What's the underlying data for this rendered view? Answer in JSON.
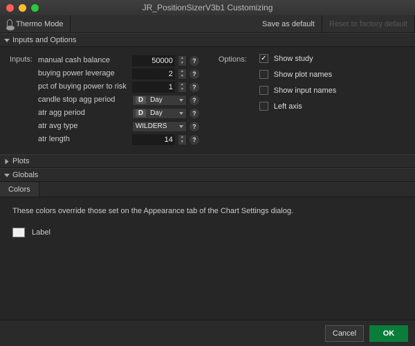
{
  "window": {
    "title": "JR_PositionSizerV3b1 Customizing"
  },
  "toolbar": {
    "thermo": "Thermo Mode",
    "save_default": "Save as default",
    "factory_reset": "Reset to factory default"
  },
  "sections": {
    "inputs_options": "Inputs and Options",
    "plots": "Plots",
    "globals": "Globals"
  },
  "inputs_label": "Inputs:",
  "options_label": "Options:",
  "params": [
    {
      "name": "manual cash balance",
      "kind": "num",
      "value": "50000"
    },
    {
      "name": "buying power leverage",
      "kind": "num",
      "value": "2"
    },
    {
      "name": "pct of buying power to risk",
      "kind": "num",
      "value": "1"
    },
    {
      "name": "candle stop agg period",
      "kind": "dd",
      "badge": "D",
      "text": "Day"
    },
    {
      "name": "atr agg period",
      "kind": "dd",
      "badge": "D",
      "text": "Day"
    },
    {
      "name": "atr avg type",
      "kind": "dd",
      "text": "WILDERS"
    },
    {
      "name": "atr length",
      "kind": "num",
      "value": "14"
    }
  ],
  "options": [
    {
      "label": "Show study",
      "checked": true
    },
    {
      "label": "Show plot names",
      "checked": false
    },
    {
      "label": "Show input names",
      "checked": false
    },
    {
      "label": "Left axis",
      "checked": false
    }
  ],
  "globals": {
    "tab": "Colors",
    "note": "These colors override those set on the Appearance tab of the Chart Settings dialog.",
    "swatch_label": "Label",
    "swatch_color": "#f0f0f0"
  },
  "footer": {
    "cancel": "Cancel",
    "ok": "OK"
  }
}
